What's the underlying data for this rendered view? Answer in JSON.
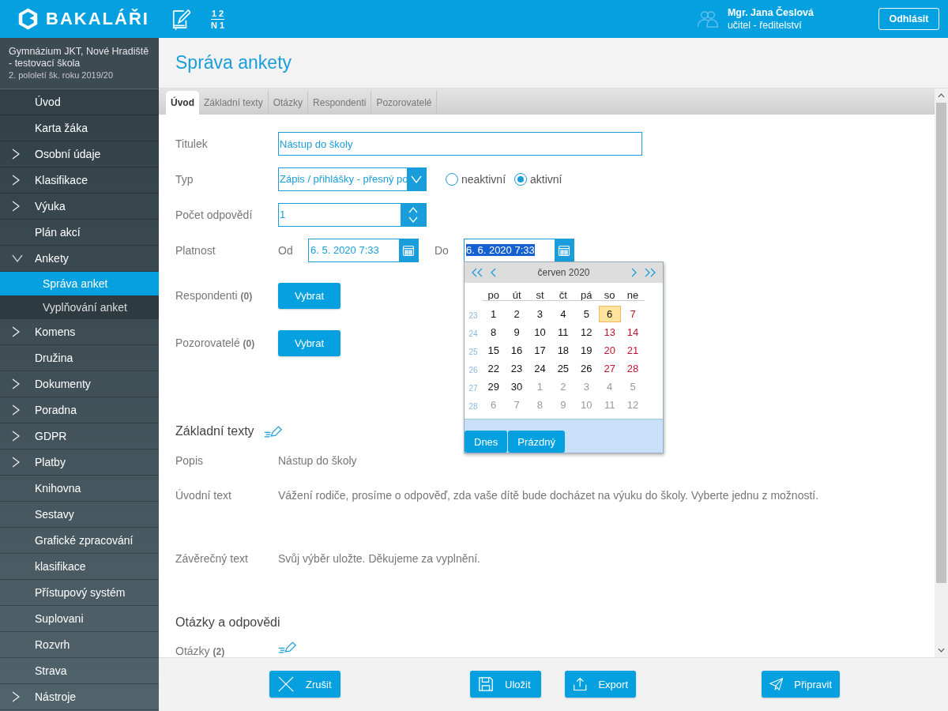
{
  "header": {
    "brand": "BAKALÁŘI",
    "fraction_top": "1 2",
    "fraction_bottom": "N 1",
    "user_name": "Mgr. Jana Česlová",
    "user_role": "učitel - ředitelství",
    "logout": "Odhlásit"
  },
  "sidebar": {
    "school": "Gymnázium JKT, Nové Hradiště - testovací škola",
    "term": "2. pololetí šk. roku 2019/20",
    "items": [
      {
        "label": "Úvod"
      },
      {
        "label": "Karta žáka"
      },
      {
        "label": "Osobní údaje",
        "expanded": false
      },
      {
        "label": "Klasifikace",
        "expanded": false
      },
      {
        "label": "Výuka",
        "expanded": false
      },
      {
        "label": "Plán akcí"
      },
      {
        "label": "Ankety",
        "expanded": true,
        "children": [
          {
            "label": "Správa anket",
            "selected": true
          },
          {
            "label": "Vyplňování anket",
            "selected": false
          }
        ]
      },
      {
        "label": "Komens",
        "expanded": false
      },
      {
        "label": "Družina"
      },
      {
        "label": "Dokumenty",
        "expanded": false
      },
      {
        "label": "Poradna",
        "expanded": false
      },
      {
        "label": "GDPR",
        "expanded": false
      },
      {
        "label": "Platby",
        "expanded": false
      },
      {
        "label": "Knihovna"
      },
      {
        "label": "Sestavy"
      },
      {
        "label": "Grafické zpracování"
      },
      {
        "label": "klasifikace"
      },
      {
        "label": "Přístupový systém"
      },
      {
        "label": "Suplovani"
      },
      {
        "label": "Rozvrh"
      },
      {
        "label": "Strava"
      },
      {
        "label": "Nástroje",
        "expanded": false
      }
    ]
  },
  "page_title": "Správa ankety",
  "tabs": [
    {
      "label": "Úvod",
      "selected": true
    },
    {
      "label": "Základní texty",
      "selected": false
    },
    {
      "label": "Otázky",
      "selected": false
    },
    {
      "label": "Respondenti",
      "selected": false
    },
    {
      "label": "Pozorovatelé",
      "selected": false
    }
  ],
  "form": {
    "title_label": "Titulek",
    "title_value": "Nástup do školy",
    "type_label": "Typ",
    "type_value": "Zápis / přihlášky - přesný po",
    "status_options": [
      {
        "label": "neaktivní",
        "selected": false
      },
      {
        "label": "aktivní",
        "selected": true
      }
    ],
    "count_label": "Počet odpovědí",
    "count_value": "1",
    "validity_label": "Platnost",
    "from_label": "Od",
    "from_value": "6. 5. 2020 7:33",
    "to_label": "Do",
    "to_value": "6. 6. 2020 7:33",
    "respondents_label": "Respondenti",
    "respondents_count": "(0)",
    "respondents_button": "Vybrat",
    "observers_label": "Pozorovatelé",
    "observers_count": "(0)",
    "observers_button": "Vybrat"
  },
  "calendar": {
    "month": "červen 2020",
    "weekdays": [
      "po",
      "út",
      "st",
      "čt",
      "pá",
      "so",
      "ne"
    ],
    "weeks": [
      {
        "week": "23",
        "days": [
          {
            "day": "1",
            "kind": "weekday",
            "selected": false
          },
          {
            "day": "2",
            "kind": "weekday",
            "selected": false
          },
          {
            "day": "3",
            "kind": "weekday",
            "selected": false
          },
          {
            "day": "4",
            "kind": "weekday",
            "selected": false
          },
          {
            "day": "5",
            "kind": "weekday",
            "selected": false
          },
          {
            "day": "6",
            "kind": "weekend",
            "selected": true
          },
          {
            "day": "7",
            "kind": "weekend",
            "selected": false
          }
        ]
      },
      {
        "week": "24",
        "days": [
          {
            "day": "8",
            "kind": "weekday",
            "selected": false
          },
          {
            "day": "9",
            "kind": "weekday",
            "selected": false
          },
          {
            "day": "10",
            "kind": "weekday",
            "selected": false
          },
          {
            "day": "11",
            "kind": "weekday",
            "selected": false
          },
          {
            "day": "12",
            "kind": "weekday",
            "selected": false
          },
          {
            "day": "13",
            "kind": "weekend",
            "selected": false
          },
          {
            "day": "14",
            "kind": "weekend",
            "selected": false
          }
        ]
      },
      {
        "week": "25",
        "days": [
          {
            "day": "15",
            "kind": "weekday",
            "selected": false
          },
          {
            "day": "16",
            "kind": "weekday",
            "selected": false
          },
          {
            "day": "17",
            "kind": "weekday",
            "selected": false
          },
          {
            "day": "18",
            "kind": "weekday",
            "selected": false
          },
          {
            "day": "19",
            "kind": "weekday",
            "selected": false
          },
          {
            "day": "20",
            "kind": "weekend",
            "selected": false
          },
          {
            "day": "21",
            "kind": "weekend",
            "selected": false
          }
        ]
      },
      {
        "week": "26",
        "days": [
          {
            "day": "22",
            "kind": "weekday",
            "selected": false
          },
          {
            "day": "23",
            "kind": "weekday",
            "selected": false
          },
          {
            "day": "24",
            "kind": "weekday",
            "selected": false
          },
          {
            "day": "25",
            "kind": "weekday",
            "selected": false
          },
          {
            "day": "26",
            "kind": "weekday",
            "selected": false
          },
          {
            "day": "27",
            "kind": "weekend",
            "selected": false
          },
          {
            "day": "28",
            "kind": "weekend",
            "selected": false
          }
        ]
      },
      {
        "week": "27",
        "days": [
          {
            "day": "29",
            "kind": "weekday",
            "selected": false
          },
          {
            "day": "30",
            "kind": "weekday",
            "selected": false
          },
          {
            "day": "1",
            "kind": "other",
            "selected": false
          },
          {
            "day": "2",
            "kind": "other",
            "selected": false
          },
          {
            "day": "3",
            "kind": "other",
            "selected": false
          },
          {
            "day": "4",
            "kind": "other",
            "selected": false
          },
          {
            "day": "5",
            "kind": "other",
            "selected": false
          }
        ]
      },
      {
        "week": "28",
        "days": [
          {
            "day": "6",
            "kind": "other",
            "selected": false
          },
          {
            "day": "7",
            "kind": "other",
            "selected": false
          },
          {
            "day": "8",
            "kind": "other",
            "selected": false
          },
          {
            "day": "9",
            "kind": "other",
            "selected": false
          },
          {
            "day": "10",
            "kind": "other",
            "selected": false
          },
          {
            "day": "11",
            "kind": "other",
            "selected": false
          },
          {
            "day": "12",
            "kind": "other",
            "selected": false
          }
        ]
      }
    ],
    "today_button": "Dnes",
    "clear_button": "Prázdný"
  },
  "texts": {
    "heading": "Základní texty",
    "rows": [
      {
        "label": "Popis",
        "value": "Nástup do školy"
      },
      {
        "label": "Úvodní text",
        "value": "Vážení rodiče, prosíme o odpověď, zda vaše dítě bude docházet na výuku do školy. Vyberte jednu z možností."
      },
      {
        "label": "Závěrečný text",
        "value": "Svůj výběr uložte. Děkujeme za vyplnění."
      }
    ]
  },
  "questions": {
    "heading": "Otázky a odpovědi",
    "label": "Otázky",
    "count": "(2)"
  },
  "footer_buttons": [
    {
      "kind": "cancel",
      "label": "Zrušit"
    },
    {
      "kind": "save",
      "label": "Uložit"
    },
    {
      "kind": "export",
      "label": "Export"
    },
    {
      "kind": "send",
      "label": "Připravit"
    }
  ]
}
